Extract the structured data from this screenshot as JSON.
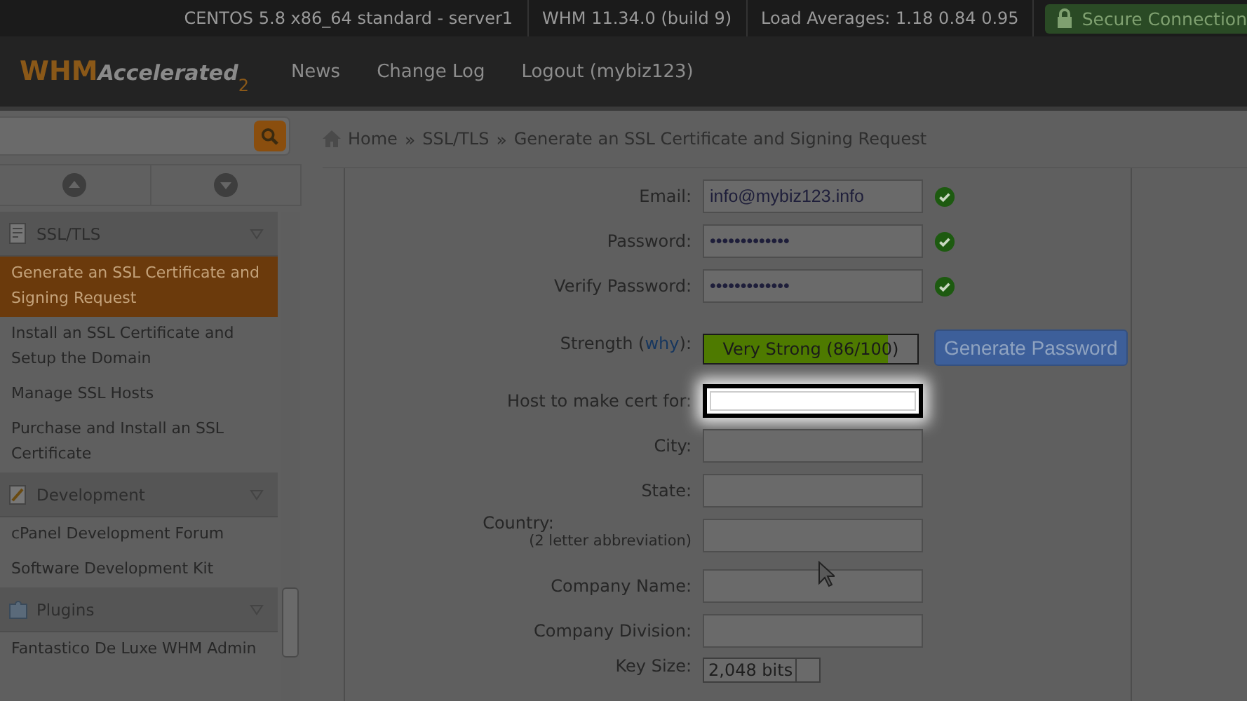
{
  "top_bar": {
    "items": [
      "CENTOS 5.8 x86_64 standard - server1",
      "WHM 11.34.0 (build 9)",
      "Load Averages: 1.18 0.84 0.95"
    ],
    "secure": "Secure Connection"
  },
  "header": {
    "logo": {
      "main": "WHM",
      "sub": "Accelerated",
      "mark": "2"
    },
    "nav": [
      "News",
      "Change Log",
      "Logout (mybiz123)"
    ]
  },
  "sidebar": {
    "groups": [
      {
        "title": "SSL/TLS",
        "items": [
          {
            "label": "Generate an SSL Certificate and Signing Request",
            "selected": true
          },
          {
            "label": "Install an SSL Certificate and Setup the Domain",
            "selected": false
          },
          {
            "label": "Manage SSL Hosts",
            "selected": false
          },
          {
            "label": "Purchase and Install an SSL Certificate",
            "selected": false
          }
        ]
      },
      {
        "title": "Development",
        "items": [
          {
            "label": "cPanel Development Forum",
            "selected": false
          },
          {
            "label": "Software Development Kit",
            "selected": false
          }
        ]
      },
      {
        "title": "Plugins",
        "items": [
          {
            "label": "Fantastico De Luxe WHM Admin",
            "selected": false
          }
        ]
      }
    ]
  },
  "breadcrumb": {
    "separator": "»",
    "items": [
      "Home",
      "SSL/TLS",
      "Generate an SSL Certificate and Signing Request"
    ]
  },
  "form": {
    "fields": [
      {
        "kind": "text",
        "label": "Email:",
        "value": "info@mybiz123.info",
        "valid": true,
        "highlighted": false
      },
      {
        "kind": "password",
        "label": "Password:",
        "value": "•••••••••••••",
        "valid": true,
        "highlighted": false
      },
      {
        "kind": "password",
        "label": "Verify Password:",
        "value": "•••••••••••••",
        "valid": true,
        "highlighted": false
      },
      {
        "kind": "strength",
        "label_before": "Strength (",
        "link": "why",
        "label_after": "):",
        "reading": "Very Strong (86/100)",
        "level": 0.86,
        "button": "Generate Password"
      },
      {
        "kind": "text",
        "label": "Host to make cert for:",
        "valid": false,
        "highlighted": true
      },
      {
        "kind": "text",
        "label": "City:",
        "valid": false,
        "highlighted": false
      },
      {
        "kind": "text",
        "label": "State:",
        "valid": false,
        "highlighted": false
      },
      {
        "kind": "text",
        "label": "Country:",
        "hint": "(2 letter abbreviation)",
        "valid": false,
        "highlighted": false
      },
      {
        "kind": "text",
        "label": "Company Name:",
        "valid": false,
        "highlighted": false
      },
      {
        "kind": "text",
        "label": "Company Division:",
        "valid": false,
        "highlighted": false
      },
      {
        "kind": "select",
        "label": "Key Size:",
        "value": "2,048 bits"
      }
    ]
  }
}
